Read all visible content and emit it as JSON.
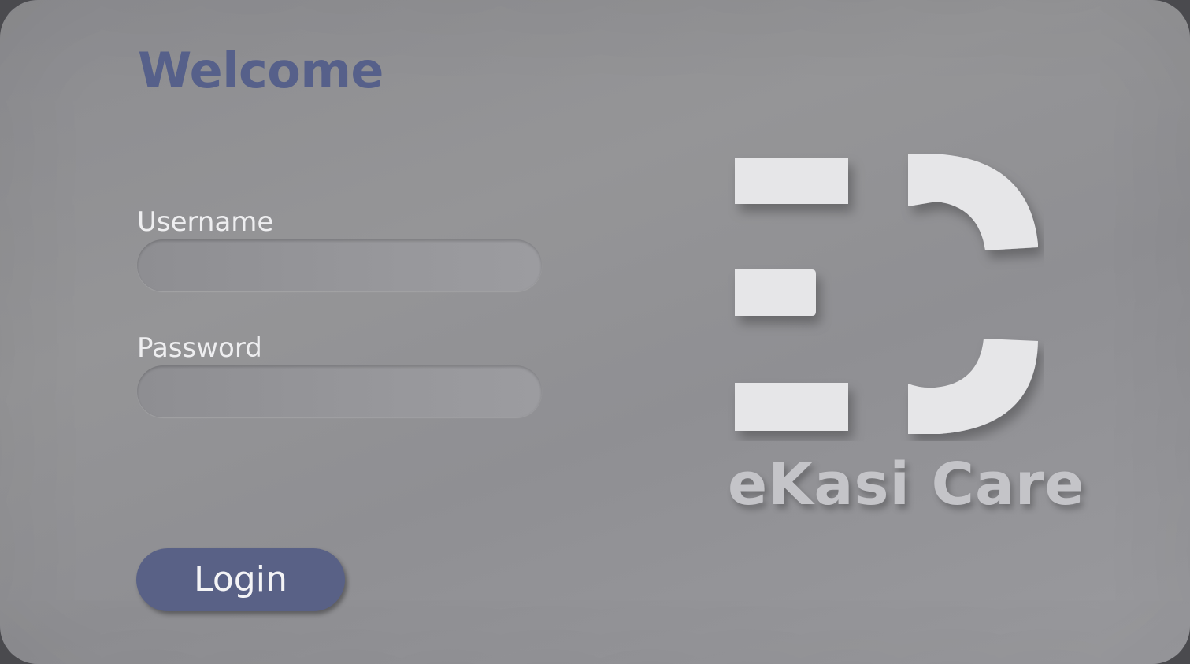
{
  "login": {
    "title": "Welcome",
    "username_label": "Username",
    "username_value": "",
    "password_label": "Password",
    "password_value": "",
    "login_button": "Login"
  },
  "brand": {
    "name": "eKasi Care",
    "logo_icon": "ekasi-care-logo-icon"
  },
  "colors": {
    "accent": "#596186",
    "title": "#56608a",
    "background": "#939397",
    "logo": "#e6e6e8"
  }
}
